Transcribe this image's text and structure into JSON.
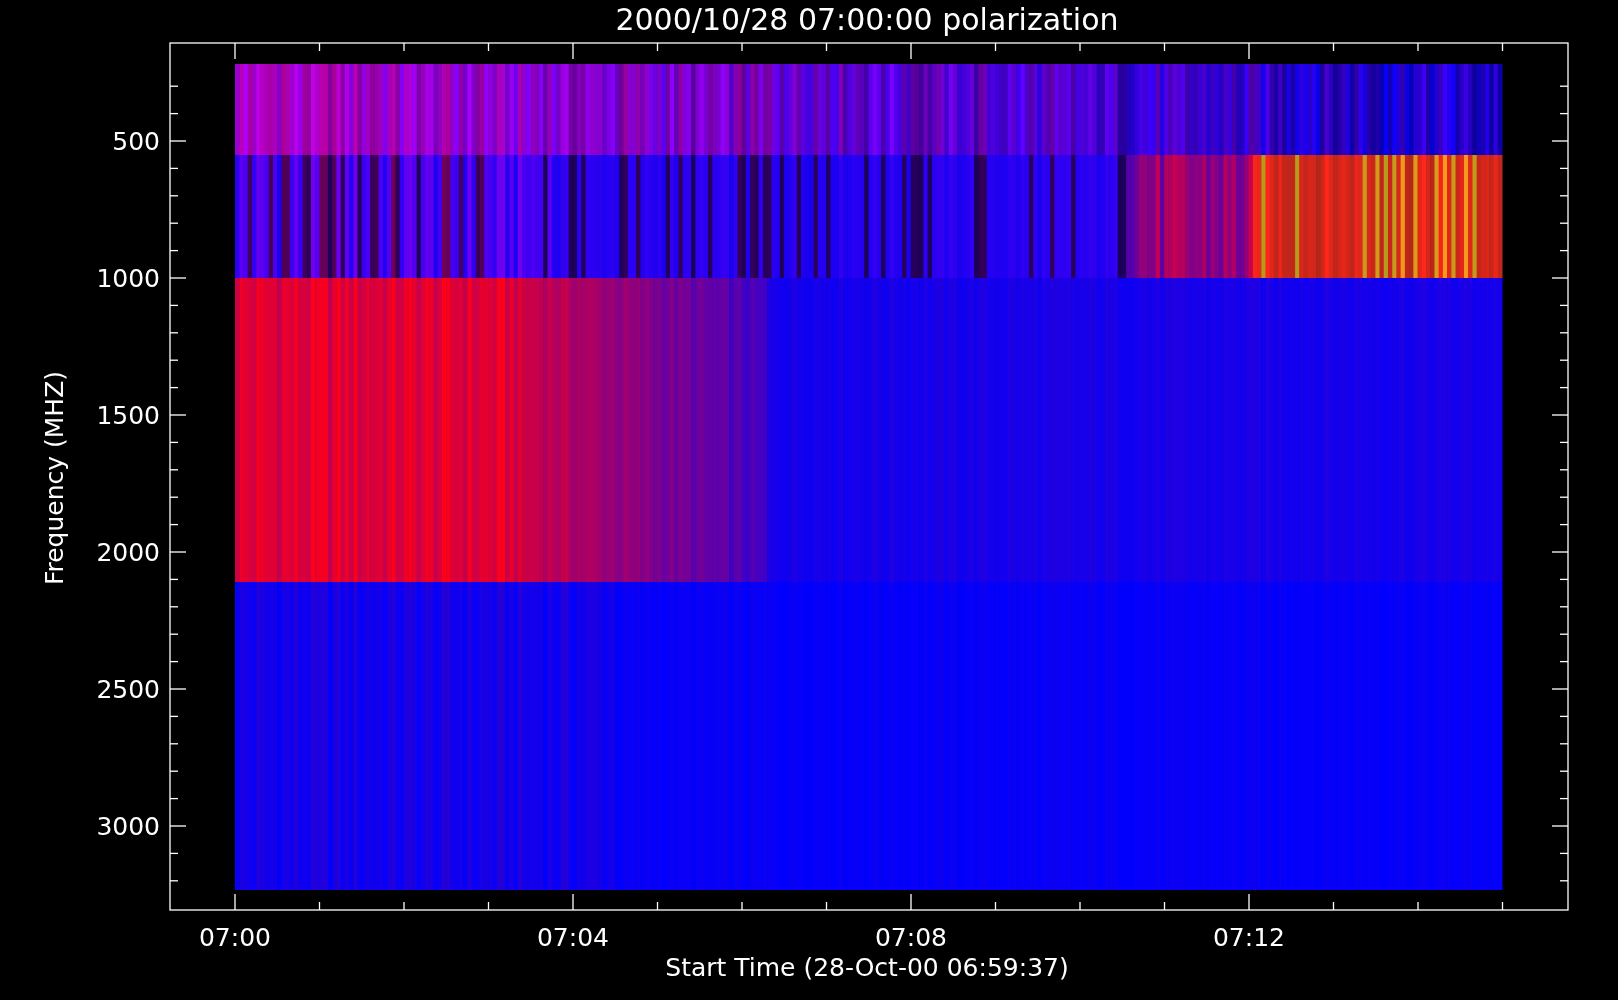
{
  "title": "2000/10/28 07:00:00 polarization",
  "y_axis": {
    "label": "Frequency (MHZ)",
    "ticks": [
      "500",
      "1000",
      "1500",
      "2000",
      "2500",
      "3000"
    ]
  },
  "x_axis": {
    "label": "Start Time (28-Oct-00 06:59:37)",
    "ticks": [
      "07:00",
      "07:04",
      "07:08",
      "07:12"
    ]
  }
}
